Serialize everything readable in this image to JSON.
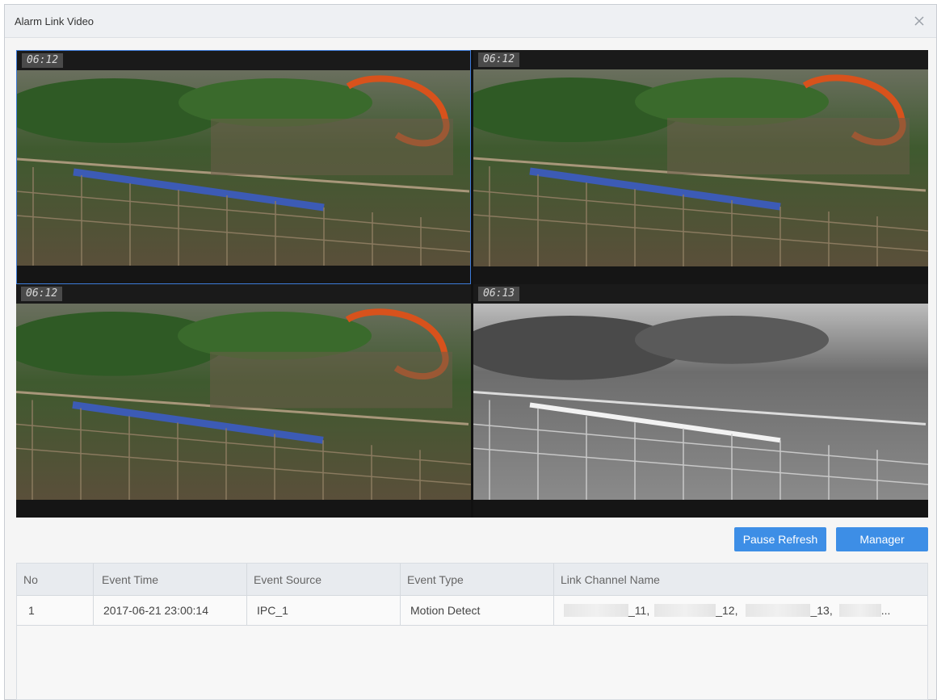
{
  "window": {
    "title": "Alarm Link Video"
  },
  "video": {
    "tiles": [
      {
        "time": "06:12",
        "mode": "color",
        "selected": true
      },
      {
        "time": "06:12",
        "mode": "color",
        "selected": false
      },
      {
        "time": "06:12",
        "mode": "color",
        "selected": false
      },
      {
        "time": "06:13",
        "mode": "mono",
        "selected": false
      }
    ]
  },
  "actions": {
    "pause_refresh": "Pause Refresh",
    "manager": "Manager"
  },
  "table": {
    "headers": [
      "No",
      "Event Time",
      "Event Source",
      "Event Type",
      "Link Channel Name"
    ],
    "rows": [
      {
        "no": "1",
        "event_time": "2017-06-21 23:00:14",
        "event_source": "IPC_1",
        "event_type": "Motion Detect",
        "link_channels": [
          "_11,",
          "_12,",
          "_13,",
          "..."
        ]
      }
    ]
  },
  "colors": {
    "accent": "#3d8ee6",
    "selected_border": "#3d7bd9"
  }
}
